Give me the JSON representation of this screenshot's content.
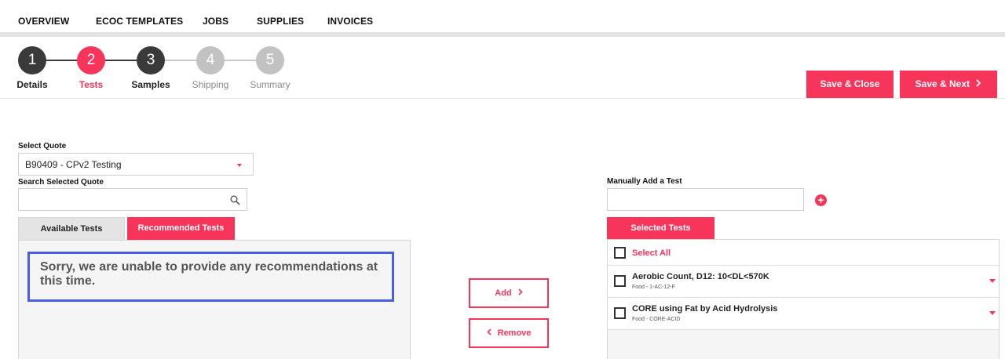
{
  "nav": {
    "items": [
      "OVERVIEW",
      "ECOC TEMPLATES",
      "JOBS",
      "SUPPLIES",
      "INVOICES"
    ]
  },
  "stepper": {
    "steps": [
      {
        "number": "1",
        "label": "Details",
        "state": "complete"
      },
      {
        "number": "2",
        "label": "Tests",
        "state": "active"
      },
      {
        "number": "3",
        "label": "Samples",
        "state": "complete"
      },
      {
        "number": "4",
        "label": "Shipping",
        "state": "pending"
      },
      {
        "number": "5",
        "label": "Summary",
        "state": "pending"
      }
    ]
  },
  "actions": {
    "save_close": "Save & Close",
    "save_next": "Save & Next"
  },
  "left": {
    "select_quote_label": "Select Quote",
    "select_quote_value": "B90409 - CPv2 Testing",
    "search_label": "Search Selected Quote",
    "search_value": "",
    "tabs": {
      "available": "Available Tests",
      "recommended": "Recommended Tests"
    },
    "message": "Sorry, we are unable to provide any recommendations at this time."
  },
  "middle": {
    "add_label": "Add",
    "remove_label": "Remove"
  },
  "right": {
    "manual_add_label": "Manually Add a Test",
    "manual_add_value": "",
    "selected_tab": "Selected Tests",
    "select_all": "Select All",
    "tests": [
      {
        "name": "Aerobic Count, D12: 10<DL<570K",
        "code": "Food - 1-AC-12-F"
      },
      {
        "name": "CORE using Fat by Acid Hydrolysis",
        "code": "Food - CORE-ACID"
      }
    ]
  },
  "colors": {
    "accent": "#f7345a",
    "dark_step": "#3a3a3a",
    "muted_step": "#c2c2c2",
    "highlight_border": "#4a5fe0"
  }
}
